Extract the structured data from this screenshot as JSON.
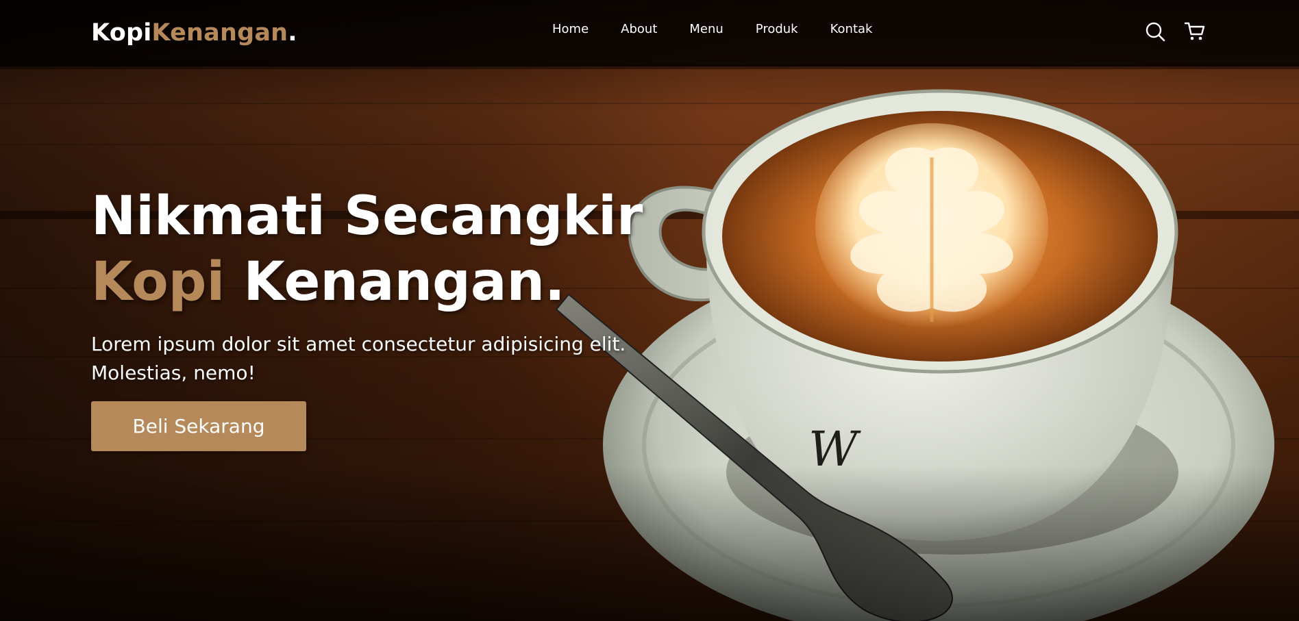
{
  "brand": {
    "name_part1": "Kopi",
    "name_part2": "Kenangan",
    "name_suffix": ".",
    "accent_color": "#b6895b"
  },
  "nav": {
    "links": [
      {
        "label": "Home"
      },
      {
        "label": "About"
      },
      {
        "label": "Menu"
      },
      {
        "label": "Produk"
      },
      {
        "label": "Kontak"
      }
    ],
    "icons": [
      "search-icon",
      "shopping-cart-icon"
    ]
  },
  "hero": {
    "title_line1": "Nikmati Secangkir",
    "title_accent": "Kopi",
    "title_line2_rest": " Kenangan.",
    "description": "Lorem ipsum dolor sit amet consectetur adipisicing elit. Molestias, nemo!",
    "cta_label": "Beli Sekarang",
    "background_image": "coffee-cup-latte-art-on-wooden-table"
  }
}
